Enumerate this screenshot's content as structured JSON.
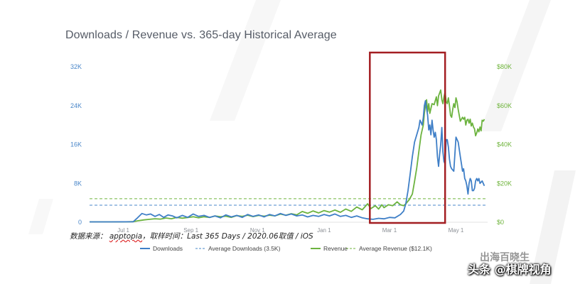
{
  "title": "Downloads / Revenue vs. 365-day Historical Average",
  "source_note": {
    "prefix": "数据来源： ",
    "brand": "apptopia",
    "suffix": "，取样时间：Last 365 Days / 2020.06取值 / iOS"
  },
  "watermark": {
    "top": "出海百晓生",
    "bottom": "头条 @棋牌视角"
  },
  "colors": {
    "downloads": "#3f7fc7",
    "revenue": "#6cb33f",
    "highlight_box": "#a31e22",
    "avg_downloads": "#4a87c9",
    "avg_revenue": "#6fb43c"
  },
  "chart_data": {
    "type": "line",
    "title": "Downloads / Revenue vs. 365-day Historical Average",
    "y_left": {
      "ticks": [
        "0",
        "8K",
        "16K",
        "24K",
        "32K"
      ],
      "lim": [
        0,
        32000
      ]
    },
    "y_right": {
      "ticks": [
        "$0",
        "$20K",
        "$40K",
        "$60K",
        "$80K"
      ],
      "lim": [
        0,
        80000
      ]
    },
    "x_ticks": [
      {
        "label": "Jul 1",
        "t": 31
      },
      {
        "label": "Sep 1",
        "t": 93
      },
      {
        "label": "Nov 1",
        "t": 154
      },
      {
        "label": "Jan 1",
        "t": 215
      },
      {
        "label": "Mar 1",
        "t": 275
      },
      {
        "label": "May 1",
        "t": 336
      }
    ],
    "x_lim": [
      0,
      365
    ],
    "grid": false,
    "legend_position": "bottom",
    "legend": [
      {
        "label": "Downloads",
        "style": "solid",
        "color": "#3f7fc7"
      },
      {
        "label": "Average Downloads (3.5K)",
        "style": "dashed",
        "color": "#4a87c9"
      },
      {
        "label": "Revenue",
        "style": "solid",
        "color": "#6cb33f"
      },
      {
        "label": "Average Revenue ($12.1K)",
        "style": "dashed",
        "color": "#6fb43c"
      }
    ],
    "averages": {
      "downloads": 3500,
      "revenue": 12100
    },
    "highlight": {
      "t_start": 257,
      "t_end": 326
    },
    "series": [
      {
        "name": "Downloads",
        "axis": "left",
        "points": [
          [
            0,
            80
          ],
          [
            20,
            80
          ],
          [
            40,
            100
          ],
          [
            44,
            900
          ],
          [
            48,
            1800
          ],
          [
            52,
            1500
          ],
          [
            56,
            1700
          ],
          [
            60,
            1200
          ],
          [
            64,
            1600
          ],
          [
            68,
            1000
          ],
          [
            72,
            1500
          ],
          [
            76,
            1300
          ],
          [
            80,
            900
          ],
          [
            85,
            1400
          ],
          [
            90,
            1000
          ],
          [
            95,
            1700
          ],
          [
            100,
            1200
          ],
          [
            105,
            1400
          ],
          [
            110,
            1000
          ],
          [
            115,
            1300
          ],
          [
            120,
            900
          ],
          [
            125,
            1500
          ],
          [
            130,
            1100
          ],
          [
            135,
            1400
          ],
          [
            140,
            1000
          ],
          [
            145,
            1600
          ],
          [
            150,
            1200
          ],
          [
            155,
            1500
          ],
          [
            160,
            1100
          ],
          [
            165,
            1600
          ],
          [
            170,
            1300
          ],
          [
            175,
            1800
          ],
          [
            180,
            1400
          ],
          [
            185,
            1700
          ],
          [
            190,
            1300
          ],
          [
            195,
            1500
          ],
          [
            200,
            1100
          ],
          [
            205,
            1400
          ],
          [
            210,
            1200
          ],
          [
            215,
            1600
          ],
          [
            220,
            1300
          ],
          [
            225,
            1700
          ],
          [
            230,
            1200
          ],
          [
            235,
            1400
          ],
          [
            240,
            1000
          ],
          [
            245,
            1300
          ],
          [
            250,
            900
          ],
          [
            255,
            700
          ],
          [
            260,
            600
          ],
          [
            265,
            800
          ],
          [
            270,
            700
          ],
          [
            275,
            1000
          ],
          [
            280,
            900
          ],
          [
            285,
            1600
          ],
          [
            288,
            2300
          ],
          [
            290,
            3800
          ],
          [
            292,
            6500
          ],
          [
            294,
            10000
          ],
          [
            296,
            13500
          ],
          [
            298,
            16500
          ],
          [
            300,
            18000
          ],
          [
            302,
            19500
          ],
          [
            303,
            21000
          ],
          [
            305,
            20000
          ],
          [
            306,
            21500
          ],
          [
            307,
            24000
          ],
          [
            308,
            25000
          ],
          [
            310,
            22000
          ],
          [
            311,
            19000
          ],
          [
            312,
            20000
          ],
          [
            313,
            18000
          ],
          [
            314,
            21000
          ],
          [
            315,
            19000
          ],
          [
            316,
            17500
          ],
          [
            317,
            18500
          ],
          [
            318,
            17000
          ],
          [
            319,
            13500
          ],
          [
            320,
            11500
          ],
          [
            321,
            14000
          ],
          [
            322,
            16000
          ],
          [
            323,
            19500
          ],
          [
            324,
            14500
          ],
          [
            325,
            12500
          ],
          [
            326,
            12000
          ],
          [
            327,
            17000
          ],
          [
            328,
            17000
          ],
          [
            329,
            15500
          ],
          [
            330,
            13000
          ],
          [
            331,
            11500
          ],
          [
            332,
            11000
          ],
          [
            334,
            10500
          ],
          [
            336,
            17500
          ],
          [
            338,
            16500
          ],
          [
            340,
            13500
          ],
          [
            341,
            12000
          ],
          [
            342,
            10500
          ],
          [
            343,
            11000
          ],
          [
            344,
            9000
          ],
          [
            345,
            8500
          ],
          [
            346,
            7500
          ],
          [
            347,
            5800
          ],
          [
            348,
            8000
          ],
          [
            349,
            9000
          ],
          [
            350,
            8500
          ],
          [
            351,
            6500
          ],
          [
            352,
            6500
          ],
          [
            353,
            7000
          ],
          [
            354,
            8500
          ],
          [
            355,
            9000
          ],
          [
            356,
            8500
          ],
          [
            357,
            9000
          ],
          [
            358,
            8000
          ],
          [
            360,
            8500
          ],
          [
            362,
            7500
          ]
        ]
      },
      {
        "name": "Revenue",
        "axis": "right",
        "points": [
          [
            0,
            200
          ],
          [
            30,
            200
          ],
          [
            40,
            300
          ],
          [
            45,
            800
          ],
          [
            50,
            1200
          ],
          [
            55,
            1500
          ],
          [
            60,
            1800
          ],
          [
            65,
            1600
          ],
          [
            70,
            2200
          ],
          [
            75,
            1800
          ],
          [
            80,
            2500
          ],
          [
            85,
            2100
          ],
          [
            90,
            2400
          ],
          [
            95,
            2800
          ],
          [
            100,
            2300
          ],
          [
            105,
            2800
          ],
          [
            110,
            2500
          ],
          [
            115,
            3200
          ],
          [
            120,
            2800
          ],
          [
            125,
            3100
          ],
          [
            130,
            2500
          ],
          [
            135,
            3400
          ],
          [
            140,
            3000
          ],
          [
            145,
            3600
          ],
          [
            150,
            2900
          ],
          [
            155,
            3500
          ],
          [
            160,
            3100
          ],
          [
            165,
            3600
          ],
          [
            170,
            3300
          ],
          [
            175,
            4200
          ],
          [
            180,
            3600
          ],
          [
            185,
            4400
          ],
          [
            190,
            3800
          ],
          [
            195,
            5500
          ],
          [
            200,
            4600
          ],
          [
            205,
            5800
          ],
          [
            210,
            4800
          ],
          [
            215,
            6000
          ],
          [
            220,
            5200
          ],
          [
            225,
            6300
          ],
          [
            230,
            5100
          ],
          [
            235,
            6800
          ],
          [
            240,
            5600
          ],
          [
            245,
            7800
          ],
          [
            250,
            6400
          ],
          [
            255,
            9500
          ],
          [
            258,
            7000
          ],
          [
            262,
            8500
          ],
          [
            265,
            6800
          ],
          [
            268,
            9000
          ],
          [
            270,
            7500
          ],
          [
            274,
            9000
          ],
          [
            278,
            8500
          ],
          [
            282,
            10500
          ],
          [
            285,
            9000
          ],
          [
            288,
            8500
          ],
          [
            290,
            9500
          ],
          [
            293,
            11500
          ],
          [
            296,
            14500
          ],
          [
            298,
            21000
          ],
          [
            300,
            28000
          ],
          [
            302,
            36500
          ],
          [
            304,
            45000
          ],
          [
            306,
            50000
          ],
          [
            307,
            56000
          ],
          [
            308,
            60000
          ],
          [
            309,
            63000
          ],
          [
            310,
            57000
          ],
          [
            311,
            61000
          ],
          [
            312,
            56000
          ],
          [
            314,
            61000
          ],
          [
            316,
            60500
          ],
          [
            318,
            64500
          ],
          [
            319,
            60000
          ],
          [
            320,
            65000
          ],
          [
            322,
            68000
          ],
          [
            323,
            63000
          ],
          [
            324,
            61000
          ],
          [
            325,
            64500
          ],
          [
            326,
            67000
          ],
          [
            327,
            62000
          ],
          [
            328,
            61000
          ],
          [
            329,
            64000
          ],
          [
            330,
            60000
          ],
          [
            331,
            55000
          ],
          [
            332,
            54000
          ],
          [
            333,
            58000
          ],
          [
            334,
            61000
          ],
          [
            335,
            59000
          ],
          [
            336,
            64000
          ],
          [
            337,
            62000
          ],
          [
            338,
            58000
          ],
          [
            340,
            52000
          ],
          [
            342,
            54000
          ],
          [
            343,
            53000
          ],
          [
            344,
            54000
          ],
          [
            345,
            50000
          ],
          [
            346,
            52500
          ],
          [
            347,
            53000
          ],
          [
            348,
            51000
          ],
          [
            349,
            53000
          ],
          [
            350,
            49500
          ],
          [
            351,
            51000
          ],
          [
            352,
            49000
          ],
          [
            353,
            48000
          ],
          [
            354,
            44500
          ],
          [
            355,
            46000
          ],
          [
            356,
            48000
          ],
          [
            357,
            46500
          ],
          [
            358,
            49000
          ],
          [
            359,
            47000
          ],
          [
            360,
            52500
          ],
          [
            361,
            52000
          ],
          [
            362,
            53000
          ]
        ]
      }
    ]
  }
}
